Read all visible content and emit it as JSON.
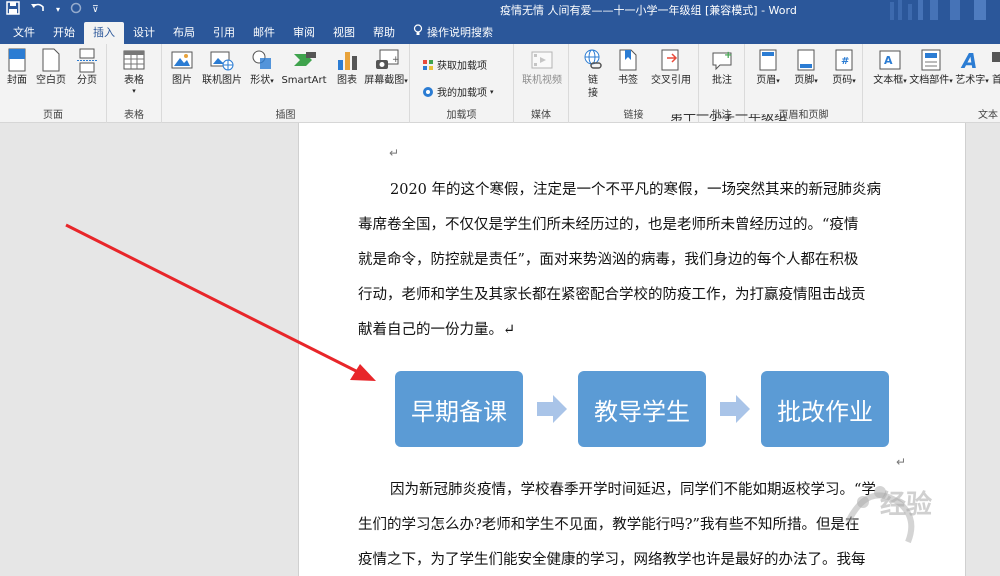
{
  "window": {
    "title": "疫情无情 人间有爱——十一小学一年级组 [兼容模式] - Word",
    "qat_icons": [
      "save-icon",
      "undo-icon",
      "redo-icon",
      "customize-icon"
    ]
  },
  "menu": {
    "tabs": [
      "文件",
      "开始",
      "插入",
      "设计",
      "布局",
      "引用",
      "邮件",
      "审阅",
      "视图",
      "帮助"
    ],
    "tell_me": "操作说明搜索",
    "active": "插入"
  },
  "ribbon": {
    "pages": {
      "label": "页面",
      "cover": "封面",
      "blank": "空白页",
      "break": "分页"
    },
    "tables": {
      "label": "表格",
      "table": "表格"
    },
    "illustrations": {
      "label": "插图",
      "picture": "图片",
      "online_picture": "联机图片",
      "shapes": "形状",
      "smartart": "SmartArt",
      "chart": "图表",
      "screenshot": "屏幕截图"
    },
    "addins": {
      "label": "加载项",
      "get": "获取加载项",
      "my": "我的加载项"
    },
    "media": {
      "label": "媒体",
      "online_video": "联机视频"
    },
    "links": {
      "label": "链接",
      "link_1": "链",
      "link_2": "接",
      "bookmark": "书签",
      "cross_ref": "交叉引用"
    },
    "comments": {
      "label": "批注",
      "comment": "批注"
    },
    "header_footer": {
      "label": "页眉和页脚",
      "header": "页眉",
      "footer": "页脚",
      "page_number": "页码"
    },
    "text": {
      "label": "文本",
      "textbox": "文本框",
      "quick_parts": "文档部件",
      "wordart": "艺术字",
      "dropcap": "首"
    }
  },
  "document": {
    "top_cut_text": "第十一小学一年级组",
    "paragraph1": [
      "2020 年的这个寒假，注定是一个不平凡的寒假，一场突然其来的新冠肺炎病",
      "毒席卷全国，不仅仅是学生们所未经历过的，也是老师所未曾经历过的。“疫情",
      "就是命令，防控就是责任”，面对来势汹汹的病毒，我们身边的每个人都在积极",
      "行动，老师和学生及其家长都在紧密配合学校的防疫工作，为打赢疫情阻击战贡",
      "献着自己的一份力量。↵"
    ],
    "smartart": [
      "早期备课",
      "教导学生",
      "批改作业"
    ],
    "paragraph2": [
      "因为新冠肺炎疫情，学校春季开学时间延迟，同学们不能如期返校学习。“学",
      "生们的学习怎么办?老师和学生不见面，教学能行吗?”我有些不知所措。但是在",
      "疫情之下，为了学生们能安全健康的学习，网络教学也许是最好的办法了。我每"
    ],
    "para_mark": "↵"
  },
  "watermark": "经验",
  "colors": {
    "brand": "#2b579a",
    "smartart_fill": "#5b9bd5",
    "smartart_arrow": "#a9c4e8",
    "annotation_arrow": "#e8262a"
  }
}
